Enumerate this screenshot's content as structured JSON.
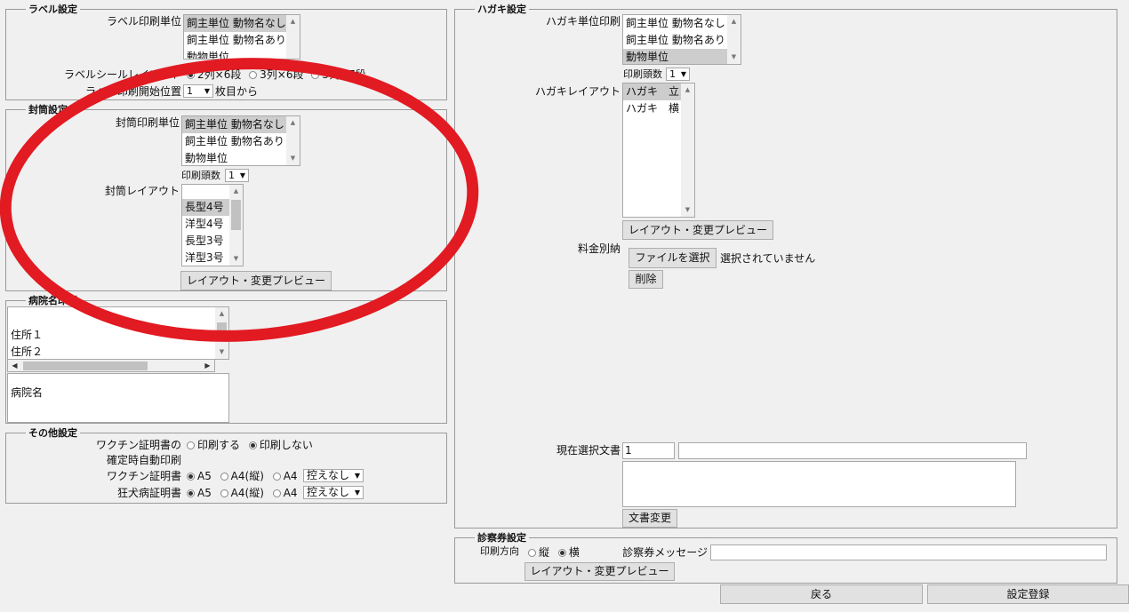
{
  "label_settings": {
    "legend": "ラベル設定",
    "unit_label": "ラベル印刷単位",
    "unit_options": [
      "飼主単位 動物名なし",
      "飼主単位 動物名あり",
      "動物単位"
    ],
    "layout_label": "ラベルシールレイアウト",
    "layout_options": [
      "2列×6段",
      "3列×6段",
      "3列×7段"
    ],
    "start_label": "ラベル印刷開始位置",
    "start_value": "1",
    "start_suffix": "枚目から"
  },
  "envelope_settings": {
    "legend": "封筒設定",
    "unit_label": "封筒印刷単位",
    "unit_options": [
      "飼主単位 動物名なし",
      "飼主単位 動物名あり",
      "動物単位"
    ],
    "copies_label": "印刷頭数",
    "copies_value": "1",
    "layout_label": "封筒レイアウト",
    "layout_options": [
      "",
      "長型4号",
      "洋型4号",
      "長型3号",
      "洋型3号"
    ],
    "preview_button": "レイアウト・変更プレビュー"
  },
  "hospital_print": {
    "legend": "病院名印刷",
    "address_items": [
      "",
      "住所１",
      "住所２"
    ],
    "name_items": [
      "病院名"
    ]
  },
  "other_settings": {
    "legend": "その他設定",
    "vaccine_auto_label_1": "ワクチン証明書の",
    "vaccine_auto_label_2": "確定時自動印刷",
    "vaccine_auto_options": [
      "印刷する",
      "印刷しない"
    ],
    "vaccine_cert_label": "ワクチン証明書",
    "rabies_cert_label": "狂犬病証明書",
    "paper_options": [
      "A5",
      "A4(縦)",
      "A4"
    ],
    "copy_select_value": "控えなし"
  },
  "postcard_settings": {
    "legend": "ハガキ設定",
    "unit_label": "ハガキ単位印刷",
    "unit_options": [
      "飼主単位 動物名なし",
      "飼主単位 動物名あり",
      "動物単位"
    ],
    "copies_label": "印刷頭数",
    "copies_value": "1",
    "layout_label": "ハガキレイアウト",
    "layout_options": [
      "ハガキ　立",
      "ハガキ　横"
    ],
    "preview_button": "レイアウト・変更プレビュー",
    "postage_label": "料金別納",
    "file_button": "ファイルを選択",
    "file_status": "選択されていません",
    "delete_button": "削除",
    "current_doc_label": "現在選択文書",
    "current_doc_number": "1",
    "current_doc_name": "",
    "change_doc_button": "文書変更"
  },
  "ticket_settings": {
    "legend": "診察券設定",
    "direction_label": "印刷方向",
    "direction_options": [
      "縦",
      "横"
    ],
    "message_label": "診察券メッセージ",
    "message_value": "",
    "preview_button": "レイアウト・変更プレビュー"
  },
  "footer": {
    "back_button": "戻る",
    "register_button": "設定登録"
  },
  "colors": {
    "annotation_red": "#e21a22",
    "selected_option_bg": "#cdcdcd"
  }
}
